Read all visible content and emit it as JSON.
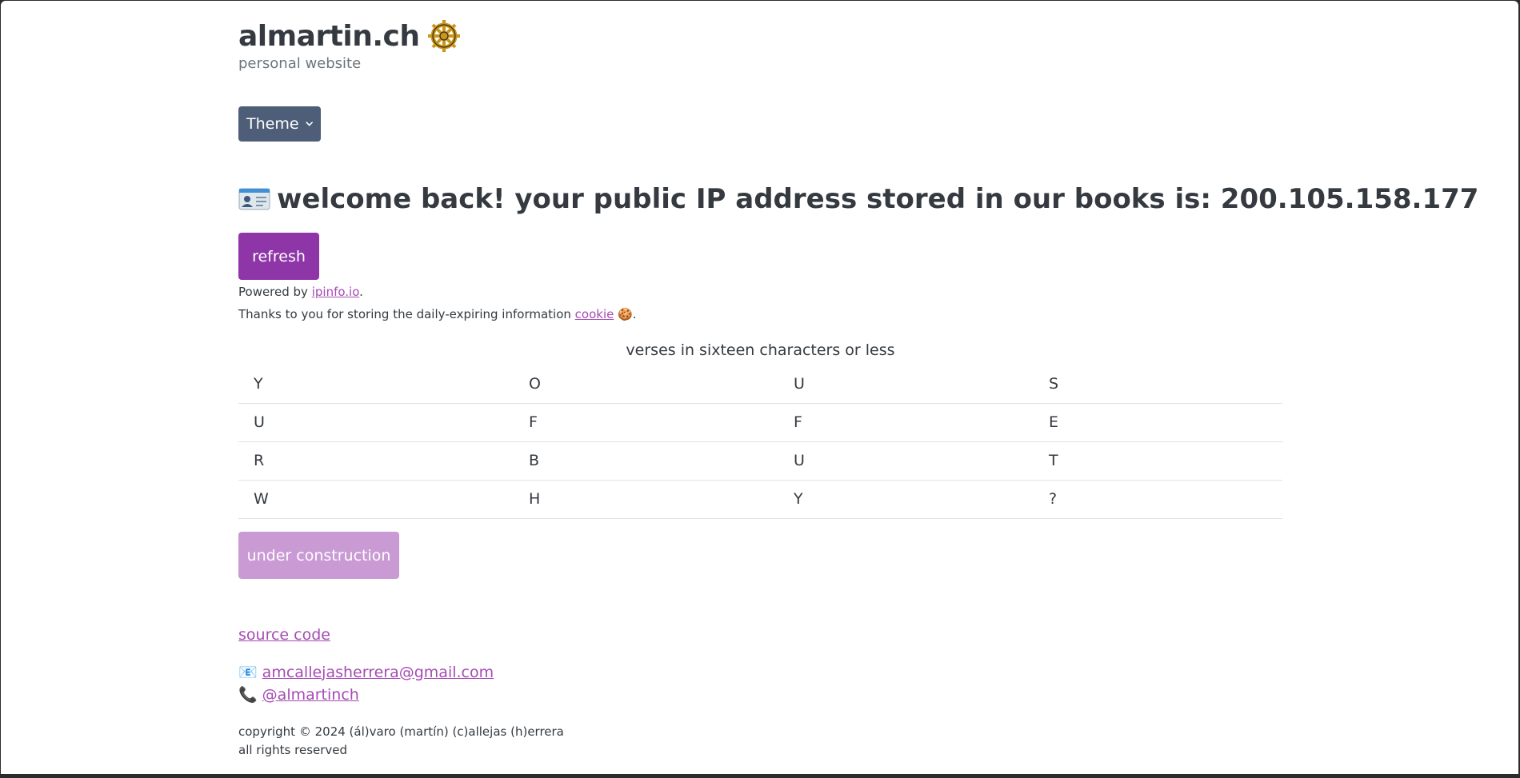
{
  "header": {
    "title": "almartin.ch",
    "subtitle": "personal website"
  },
  "theme_button": {
    "label": "Theme"
  },
  "headline": {
    "text": "welcome back! your public IP address stored in our books is: 200.105.158.177"
  },
  "refresh_button": {
    "label": "refresh"
  },
  "powered": {
    "prefix": "Powered by ",
    "link": "ipinfo.io",
    "suffix": "."
  },
  "thanks": {
    "prefix": "Thanks to you for storing the daily-expiring information ",
    "link": "cookie",
    "suffix": "🍪."
  },
  "verses": {
    "caption": "verses in sixteen characters or less",
    "rows": [
      [
        "Y",
        "O",
        "U",
        "S"
      ],
      [
        "U",
        "F",
        "F",
        "E"
      ],
      [
        "R",
        "B",
        "U",
        "T"
      ],
      [
        "W",
        "H",
        "Y",
        "?"
      ]
    ]
  },
  "construction_button": {
    "label": "under construction"
  },
  "footer": {
    "source_link": "source code",
    "email_icon": "📧",
    "email": "amcallejasherrera@gmail.com",
    "phone_icon": "📞",
    "handle": "@almartinch",
    "copyright": "copyright © 2024 (ál)varo (martín) (c)allejas (h)errera",
    "rights": "all rights reserved"
  },
  "colors": {
    "theme_button": "#4e5d78",
    "primary": "#8e36a8",
    "primary_disabled": "#c99ad4",
    "link": "#a54bb3"
  }
}
